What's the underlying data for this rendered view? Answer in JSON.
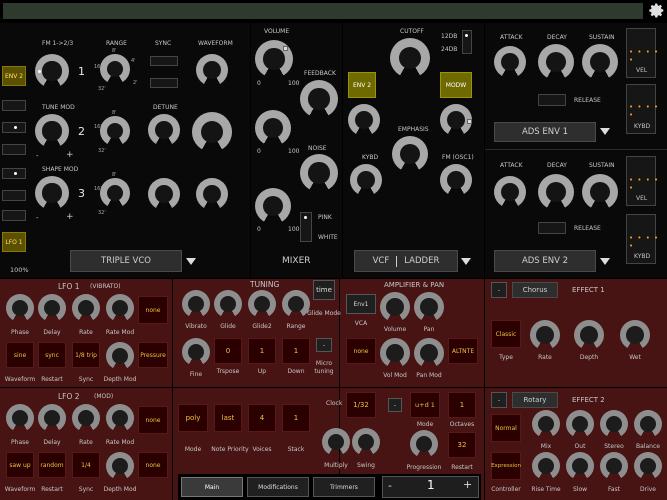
{
  "top": {
    "percent": "100%"
  },
  "vco": {
    "fm": "FM 1->2/3",
    "range": "RANGE",
    "sync": "SYNC",
    "waveform": "WAVEFORM",
    "tune_mod": "TUNE MOD",
    "detune": "DETUNE",
    "shape_mod": "SHAPE MOD",
    "env2": "ENV 2",
    "lfo1": "LFO 1",
    "osc": [
      "1",
      "2",
      "3"
    ],
    "select": "TRIPLE VCO",
    "range_ticks": [
      "8'",
      "4'",
      "2'",
      "16'",
      "32'"
    ]
  },
  "mixer": {
    "volume": "VOLUME",
    "feedback": "FEEDBACK",
    "noise": "NOISE",
    "pink": "PINK",
    "white": "WHITE",
    "title": "MIXER",
    "zero": "0",
    "hundred": "100"
  },
  "vcf": {
    "cutoff": "CUTOFF",
    "db12": "12DB",
    "db24": "24DB",
    "env2": "ENV 2",
    "modw": "MODW",
    "emphasis": "EMPHASIS",
    "kybd": "KYBD",
    "fm": "FM (OSC1)",
    "select_a": "VCF",
    "select_b": "LADDER"
  },
  "env": {
    "attack": "ATTACK",
    "decay": "DECAY",
    "sustain": "SUSTAIN",
    "release": "RELEASE",
    "vel": "VEL",
    "kybd": "KYBD",
    "env1": "ADS ENV 1",
    "env2": "ADS ENV 2",
    "dots": "• • • • •"
  },
  "lfo1": {
    "title": "LFO 1",
    "sub": "(VIBRATO)",
    "phase": "Phase",
    "delay": "Delay",
    "rate": "Rate",
    "rate_mod": "Rate Mod",
    "none": "none",
    "waveform_val": "sine",
    "restart_val": "sync",
    "sync_val": "1/8 trip",
    "pressure": "Pressure",
    "waveform": "Waveform",
    "restart": "Restart",
    "sync": "Sync",
    "depth_mod": "Depth Mod"
  },
  "lfo2": {
    "title": "LFO 2",
    "sub": "(MOD)",
    "phase": "Phase",
    "delay": "Delay",
    "rate": "Rate",
    "rate_mod": "Rate Mod",
    "none": "none",
    "none2": "none",
    "waveform_val": "saw up",
    "restart_val": "random",
    "sync_val": "1/4",
    "waveform": "Waveform",
    "restart": "Restart",
    "sync": "Sync",
    "depth_mod": "Depth Mod"
  },
  "tuning": {
    "title": "TUNING",
    "time": "time",
    "glide_mode": "Glide Mode",
    "vibrato": "Vibrato",
    "glide": "Glide",
    "glide2": "Glide2",
    "range": "Range",
    "fine": "Fine",
    "trspose": "Trspose",
    "up": "Up",
    "down": "Down",
    "micro": "Micro",
    "tuning": "tuning",
    "trspose_val": "0",
    "up_val": "1",
    "down_val": "1",
    "dash": "-"
  },
  "voice": {
    "mode_val": "poly",
    "priority_val": "last",
    "voices_val": "4",
    "stack_val": "1",
    "mode": "Mode",
    "priority": "Note Priority",
    "voices": "Voices",
    "stack": "Stack"
  },
  "amp": {
    "title": "AMPLIFIER & PAN",
    "env": "Env1",
    "vca": "VCA",
    "volume": "Volume",
    "pan": "Pan",
    "none": "none",
    "vol_mod": "Vol Mod",
    "pan_mod": "Pan Mod",
    "altnte": "ALTNTE"
  },
  "clock": {
    "clock": "Clock",
    "val": "1/32",
    "dash": "-",
    "mode_val": "u+d 1",
    "oct_val": "1",
    "mode": "Mode",
    "octaves": "Octaves",
    "multiply": "Multiply",
    "swing": "Swing",
    "progression": "Progression",
    "restart": "Restart",
    "restart_val": "32"
  },
  "fx1": {
    "dash": "-",
    "name": "Chorus",
    "title": "EFFECT 1",
    "type_val": "Classic",
    "type": "Type",
    "rate": "Rate",
    "depth": "Depth",
    "wet": "Wet"
  },
  "fx2": {
    "dash": "-",
    "name": "Rotary",
    "title": "EFFECT 2",
    "normal": "Normal",
    "mix": "Mix",
    "out": "Out",
    "stereo": "Stereo",
    "balance": "Balance",
    "expression": "Expression",
    "controller": "Controller",
    "rise": "Rise Time",
    "slow": "Slow",
    "fast": "Fast",
    "drive": "Drive"
  },
  "bottom": {
    "main": "Main",
    "modifications": "Modifications",
    "trimmers": "Trimmers",
    "minus": "-",
    "value": "1",
    "plus": "+"
  }
}
